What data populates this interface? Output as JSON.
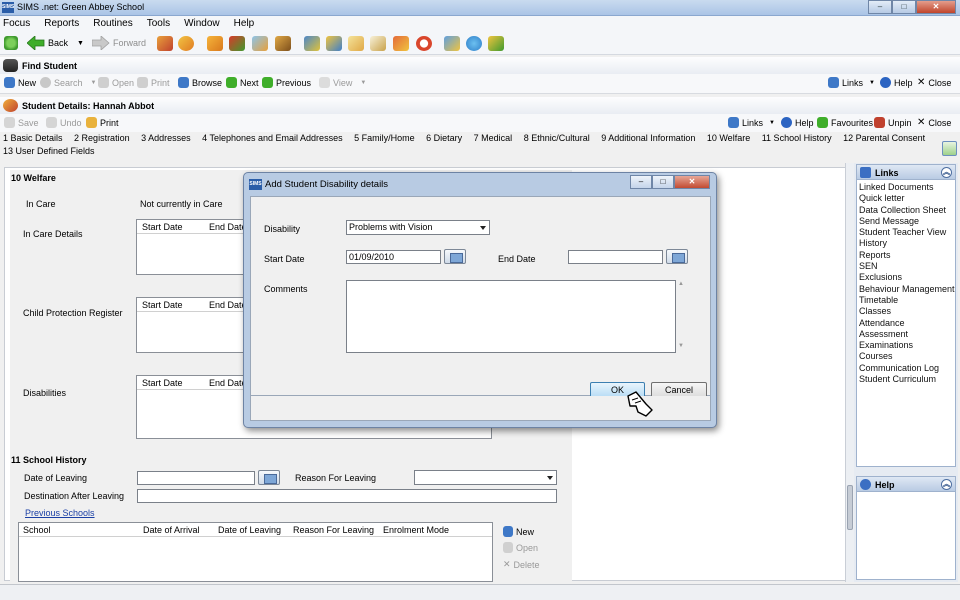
{
  "app": {
    "title": "SIMS .net: Green Abbey School",
    "logo_text": "SIMS"
  },
  "window_buttons": {
    "minimize": "–",
    "maximize": "□",
    "close": "✕"
  },
  "menu": [
    "Focus",
    "Reports",
    "Routines",
    "Tools",
    "Window",
    "Help"
  ],
  "toolbar": {
    "back": "Back",
    "forward": "Forward"
  },
  "find_student": {
    "title": "Find Student",
    "commands": {
      "new": "New",
      "search": "Search",
      "open": "Open",
      "print": "Print",
      "browse": "Browse",
      "next": "Next",
      "previous": "Previous",
      "view": "View"
    },
    "right": {
      "links": "Links",
      "help": "Help",
      "close": "Close"
    }
  },
  "student_details": {
    "title": "Student Details: Hannah Abbot",
    "commands": {
      "save": "Save",
      "undo": "Undo",
      "print": "Print"
    },
    "right": {
      "links": "Links",
      "help": "Help",
      "favourites": "Favourites",
      "unpin": "Unpin",
      "close": "Close"
    },
    "tabs": [
      "1 Basic Details",
      "2 Registration",
      "3 Addresses",
      "4 Telephones and Email Addresses",
      "5 Family/Home",
      "6 Dietary",
      "7 Medical",
      "8 Ethnic/Cultural",
      "9 Additional Information",
      "10 Welfare",
      "11 School History",
      "12 Parental Consent",
      "13 User Defined Fields"
    ]
  },
  "welfare": {
    "heading": "10 Welfare",
    "in_care_label": "In Care",
    "in_care_value": "Not currently in Care",
    "in_care_details_label": "In Care Details",
    "child_protection_label": "Child Protection Register",
    "disabilities_label": "Disabilities",
    "col_start": "Start Date",
    "col_end": "End Date"
  },
  "school_history": {
    "heading": "11 School History",
    "date_of_leaving": "Date of Leaving",
    "reason_for_leaving": "Reason For Leaving",
    "destination": "Destination After Leaving",
    "previous_schools": "Previous Schools",
    "columns": [
      "School",
      "Date of Arrival",
      "Date of Leaving",
      "Reason For Leaving",
      "Enrolment Mode"
    ],
    "actions": {
      "new": "New",
      "open": "Open",
      "delete": "Delete"
    }
  },
  "links_panel": {
    "title": "Links",
    "items": [
      "Linked Documents",
      "Quick letter",
      "Data Collection Sheet",
      "Send Message",
      "Student Teacher View",
      "History",
      "Reports",
      "SEN",
      "Exclusions",
      "Behaviour Management",
      "Timetable",
      "Classes",
      "Attendance",
      "Assessment",
      "Examinations",
      "Courses",
      "Communication Log",
      "Student Curriculum"
    ]
  },
  "help_panel": {
    "title": "Help"
  },
  "dialog": {
    "title": "Add Student Disability details",
    "disability_label": "Disability",
    "disability_value": "Problems with Vision",
    "start_date_label": "Start Date",
    "start_date_value": "01/09/2010",
    "end_date_label": "End Date",
    "end_date_value": "",
    "comments_label": "Comments",
    "ok": "OK",
    "cancel": "Cancel"
  }
}
